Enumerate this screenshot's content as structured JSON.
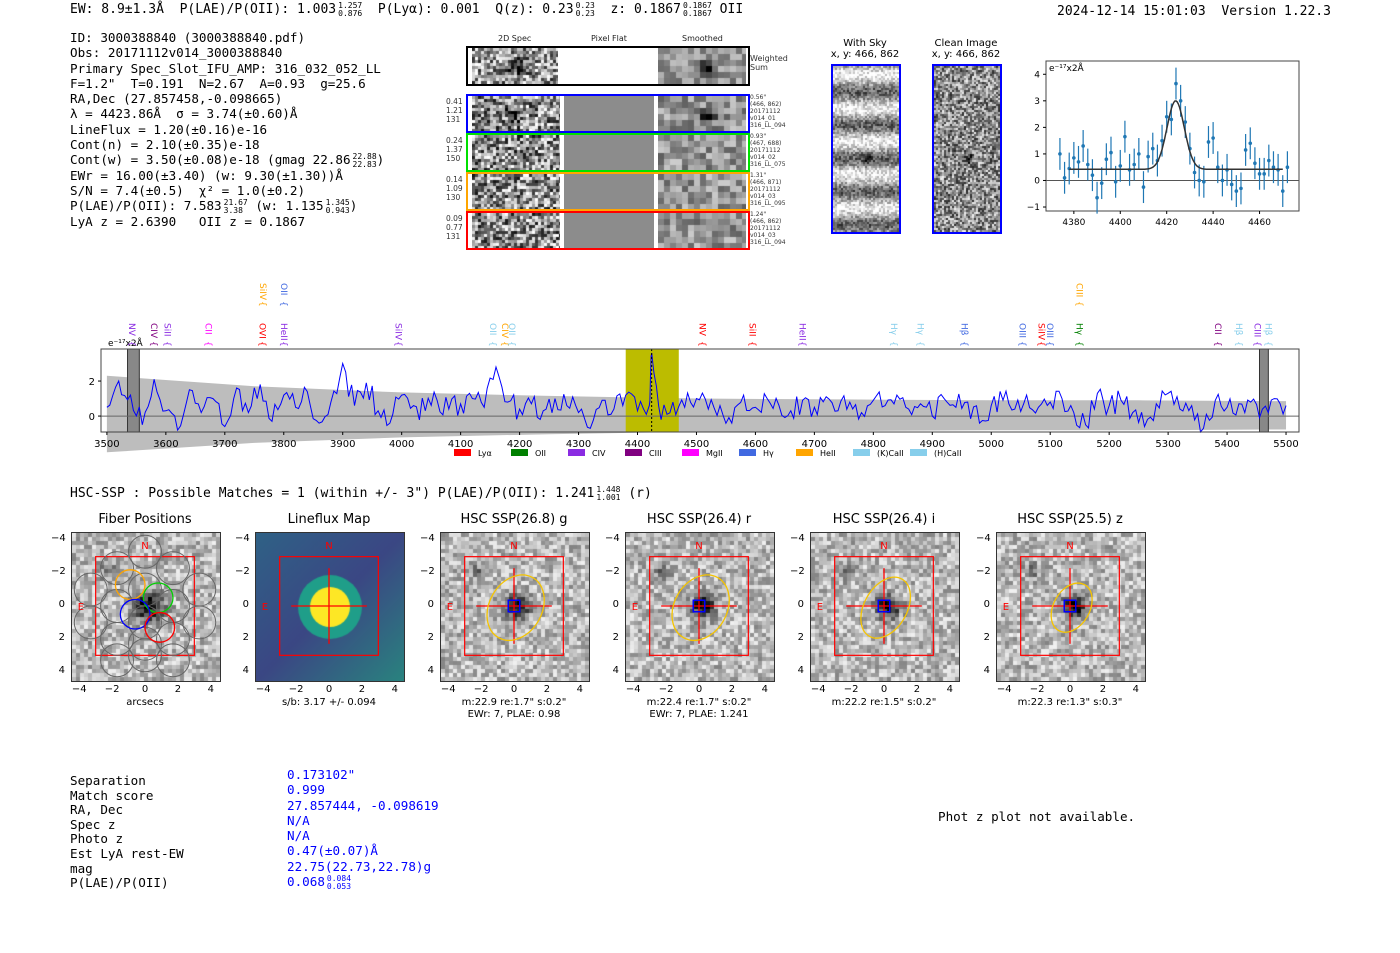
{
  "header": {
    "ew": "EW: 8.9±1.3Å",
    "plae_label": "P(LAE)/P(OII): 1.003",
    "plae_hi": "1.257",
    "plae_lo": "0.876",
    "plya": "P(Lyα): 0.001",
    "qz": "Q(z): 0.23",
    "qz_hi": "0.23",
    "qz_lo": "0.23",
    "z": "z: 0.1867",
    "z_hi": "0.1867",
    "z_lo": "0.1867",
    "z_line": "OII",
    "timestamp": "2024-12-14 15:01:03",
    "version": "Version 1.22.3"
  },
  "info": {
    "id": "ID: 3000388840 (3000388840.pdf)",
    "obs": "Obs: 20171112v014_3000388840",
    "primary": "Primary Spec_Slot_IFU_AMP: 316_032_052_LL",
    "params": "F=1.2\"  T=0.191  N=2.67  A=0.93  g=25.6",
    "radec": "RA,Dec (27.857458,-0.098665)",
    "lambda": "λ = 4423.86Å  σ = 3.74(±0.60)Å",
    "lineflux": "LineFlux = 1.20(±0.16)e-16",
    "contn": "Cont(n) = 2.10(±0.35)e-18",
    "contw": "Cont(w) = 3.50(±0.08)e-18 (gmag 22.86",
    "contw_hi": "22.88",
    "contw_lo": "22.83",
    "contw_end": ")",
    "ewr": "EWr = 16.00(±3.40) (w: 9.30(±1.30))Å",
    "sn": "S/N = 7.4(±0.5)  χ² = 1.0(±0.2)",
    "plae": "P(LAE)/P(OII): 7.583",
    "plae_hi": "21.67",
    "plae_lo": "3.38",
    "plae_w": "(w: 1.135",
    "plae_w_hi": "1.345",
    "plae_w_lo": "0.943",
    "plae_w_end": ")",
    "z": "LyA z = 2.6390   OII z = 0.1867"
  },
  "spec2d": {
    "columns": [
      "2D Spec",
      "Pixel Flat",
      "Smoothed"
    ],
    "weighted_label": "Weighted\nSum",
    "rows": [
      {
        "color": "#0000ff",
        "left": "0.41\n1.21\n131",
        "right": "0.56\"\n(466, 862)\n20171112\nv014_01\n316_LL_094"
      },
      {
        "color": "#00e000",
        "left": "0.24\n1.37\n150",
        "right": "0.93\"\n(467, 688)\n20171112\nv014_02\n316_LL_075"
      },
      {
        "color": "#ffa500",
        "left": "0.14\n1.09\n130",
        "right": "1.31\"\n(466, 871)\n20171112\nv014_03\n316_LL_095"
      },
      {
        "color": "#ff0000",
        "left": "0.09\n0.77\n131",
        "right": "1.24\"\n(466, 862)\n20171112\nv014_03\n316_LL_094"
      }
    ]
  },
  "cutouts": {
    "with_sky": "With Sky\nx, y: 466, 862",
    "clean": "Clean Image\nx, y: 466, 862"
  },
  "chart_data": [
    {
      "type": "scatter",
      "unit_label": "e⁻¹⁷x2Å",
      "xlim": [
        4368,
        4477
      ],
      "ylim": [
        -1.15,
        4.5
      ],
      "xticks": [
        "4380",
        "4400",
        "4420",
        "4440",
        "4460"
      ],
      "yticks": [
        "4",
        "3",
        "2",
        "1",
        "0",
        "−1"
      ],
      "points_x": [
        4374,
        4376,
        4378,
        4380,
        4382,
        4384,
        4386,
        4388,
        4390,
        4392,
        4394,
        4396,
        4398,
        4400,
        4402,
        4404,
        4406,
        4408,
        4410,
        4412,
        4414,
        4416,
        4418,
        4420,
        4422,
        4424,
        4426,
        4428,
        4430,
        4432,
        4434,
        4436,
        4438,
        4440,
        4442,
        4444,
        4446,
        4448,
        4450,
        4452,
        4454,
        4456,
        4458,
        4460,
        4462,
        4464,
        4466,
        4468,
        4470,
        4472
      ],
      "points_y": [
        1.0,
        0.1,
        0.45,
        0.85,
        0.7,
        1.3,
        0.6,
        0.2,
        -0.65,
        -0.1,
        0.8,
        1.05,
        -0.05,
        0.55,
        1.65,
        0.4,
        0.6,
        1.0,
        -0.25,
        0.9,
        1.2,
        0.75,
        1.5,
        2.4,
        2.3,
        3.65,
        3.0,
        2.2,
        1.2,
        0.3,
        0.0,
        -0.05,
        1.45,
        1.6,
        0.5,
        0.0,
        0.4,
        -0.15,
        -0.4,
        -0.3,
        1.15,
        1.4,
        0.65,
        0.25,
        0.25,
        0.75,
        0.5,
        0.4,
        -0.4,
        0.5
      ],
      "error": 0.6,
      "fit": {
        "center": 4423.86,
        "sigma": 3.74,
        "continuum": 0.42,
        "amplitude": 2.58,
        "range": [
          4378,
          4470
        ]
      }
    },
    {
      "type": "line",
      "unit_label": "e⁻¹⁷x2Å",
      "xlim": [
        3490,
        5522
      ],
      "ylim": [
        -0.91,
        3.83
      ],
      "xticks": [
        "3500",
        "3600",
        "3700",
        "3800",
        "3900",
        "4000",
        "4100",
        "4200",
        "4300",
        "4400",
        "4500",
        "4600",
        "4700",
        "4800",
        "4900",
        "5000",
        "5100",
        "5200",
        "5300",
        "5400",
        "5500"
      ],
      "yticks": [
        "2",
        "0"
      ],
      "x_start": 3500,
      "x_step": 20,
      "flux": [
        0.5,
        2.0,
        1.2,
        -0.5,
        2.1,
        0.3,
        -0.8,
        1.5,
        0.2,
        1.0,
        -0.6,
        1.6,
        0.2,
        1.8,
        -0.3,
        1.2,
        0.5,
        1.4,
        -0.4,
        0.8,
        3.0,
        0.6,
        1.9,
        0.3,
        -0.4,
        1.2,
        0.6,
        0.3,
        0.9,
        0.4,
        0.7,
        1.0,
        0.5,
        2.8,
        0.8,
        0.4,
        0.7,
        0.3,
        1.0,
        0.6,
        0.2,
        -0.7,
        0.9,
        0.4,
        1.2,
        0.3,
        0.6,
        -0.2,
        0.8,
        0.5,
        1.0,
        0.4,
        0.6,
        -0.4,
        1.2,
        0.5,
        1.0,
        0.6,
        0.3,
        0.9,
        0.5,
        1.1,
        0.3,
        0.8,
        0.2,
        0.9,
        0.6,
        1.2,
        0.4,
        0.7,
        0.0,
        1.0,
        0.5,
        0.8,
        -0.4,
        0.6,
        0.9,
        0.4,
        1.2,
        0.5,
        0.8,
        1.0,
        0.2,
        -0.5,
        1.3,
        0.6,
        0.9,
        0.2,
        -0.6,
        0.7,
        1.3,
        0.4,
        0.6,
        -0.7,
        0.9,
        0.5,
        0.7,
        0.8,
        0.4,
        1.0,
        0.6
      ],
      "peaks": [
        {
          "x": 4424,
          "y": 3.6
        }
      ],
      "error_band_x": [
        3500,
        3750,
        4000,
        4250,
        4500,
        4750,
        5000,
        5250,
        5500
      ],
      "error_band": [
        2.3,
        1.7,
        1.35,
        1.15,
        1.0,
        0.95,
        0.9,
        0.9,
        0.85
      ],
      "highlight_band": [
        4380,
        4470
      ],
      "highlight_color": "#bcbc00",
      "masked_bands": [
        [
          3535,
          3555
        ],
        [
          5455,
          5470
        ]
      ],
      "line_labels": [
        {
          "t": "NV",
          "w": 3543,
          "c": "#8a2be2",
          "r": 0
        },
        {
          "t": "CIV",
          "w": 3580,
          "c": "#800080",
          "r": 0
        },
        {
          "t": "SiII",
          "w": 3603,
          "c": "#8a2be2",
          "r": 0
        },
        {
          "t": "CII",
          "w": 3672,
          "c": "#ff00ff",
          "r": 0
        },
        {
          "t": "OVI",
          "w": 3764,
          "c": "#ff0000",
          "r": 0
        },
        {
          "t": "HeII",
          "w": 3800,
          "c": "#8a2be2",
          "r": 0
        },
        {
          "t": "SiIV",
          "w": 3765,
          "c": "#ffa500",
          "r": 1
        },
        {
          "t": "OII",
          "w": 3800,
          "c": "#4169e1",
          "r": 1
        },
        {
          "t": "SiIV",
          "w": 3995,
          "c": "#8a2be2",
          "r": 0
        },
        {
          "t": "OII",
          "w": 4155,
          "c": "#87ceeb",
          "r": 0
        },
        {
          "t": "CIV",
          "w": 4175,
          "c": "#ffa500",
          "r": 0
        },
        {
          "t": "OII",
          "w": 4187,
          "c": "#87ceeb",
          "r": 0
        },
        {
          "t": "NV",
          "w": 4510,
          "c": "#ff0000",
          "r": 0
        },
        {
          "t": "SiII",
          "w": 4595,
          "c": "#ff0000",
          "r": 0
        },
        {
          "t": "HeII",
          "w": 4680,
          "c": "#8a2be2",
          "r": 0
        },
        {
          "t": "Hγ",
          "w": 4835,
          "c": "#87ceeb",
          "r": 0
        },
        {
          "t": "Hγ",
          "w": 4880,
          "c": "#87ceeb",
          "r": 0
        },
        {
          "t": "Hβ",
          "w": 4955,
          "c": "#4169e1",
          "r": 0
        },
        {
          "t": "OIII",
          "w": 5053,
          "c": "#4169e1",
          "r": 0
        },
        {
          "t": "SiIV",
          "w": 5085,
          "c": "#ff0000",
          "r": 0
        },
        {
          "t": "OIII",
          "w": 5100,
          "c": "#4169e1",
          "r": 0
        },
        {
          "t": "Hγ",
          "w": 5150,
          "c": "#008000",
          "r": 0
        },
        {
          "t": "CIII",
          "w": 5150,
          "c": "#ffa500",
          "r": 1
        },
        {
          "t": "CII",
          "w": 5385,
          "c": "#800080",
          "r": 0
        },
        {
          "t": "Hβ",
          "w": 5420,
          "c": "#87ceeb",
          "r": 0
        },
        {
          "t": "CIII",
          "w": 5452,
          "c": "#8a2be2",
          "r": 0
        },
        {
          "t": "Hβ",
          "w": 5470,
          "c": "#87ceeb",
          "r": 0
        }
      ],
      "legend": [
        {
          "t": "Lyα",
          "c": "#ff0000"
        },
        {
          "t": "OII",
          "c": "#008000"
        },
        {
          "t": "CIV",
          "c": "#8a2be2"
        },
        {
          "t": "CIII",
          "c": "#800080"
        },
        {
          "t": "MgII",
          "c": "#ff00ff"
        },
        {
          "t": "Hγ",
          "c": "#4169e1"
        },
        {
          "t": "HeII",
          "c": "#ffa500"
        },
        {
          "t": "(K)CaII",
          "c": "#87ceeb"
        },
        {
          "t": "(H)CaII",
          "c": "#87ceeb"
        }
      ],
      "legend_placement": "bottom"
    }
  ],
  "hsc": {
    "heading": "HSC-SSP : Possible Matches = 1 (within +/- 3\")  P(LAE)/P(OII): 1.241",
    "heading_hi": "1.448",
    "heading_lo": "1.001",
    "heading_end": "(r)",
    "ticks": [
      "4",
      "2",
      "0",
      "−2",
      "−4"
    ],
    "xticks": [
      "−4",
      "−2",
      "0",
      "2",
      "4"
    ],
    "compass_n": "N",
    "compass_e": "E",
    "panels": [
      {
        "title": "Fiber Positions",
        "caption": "arcsecs",
        "caption2": ""
      },
      {
        "title": "Lineflux Map",
        "caption": "s/b: 3.17 +/- 0.094",
        "caption2": ""
      },
      {
        "title": "HSC SSP(26.8) g",
        "caption": "m:22.9  re:1.7\"  s:0.2\"",
        "caption2": "EWr: 7, PLAE: 0.98"
      },
      {
        "title": "HSC SSP(26.4) r",
        "caption": "m:22.4  re:1.7\"  s:0.2\"",
        "caption2": "EWr: 7, PLAE: 1.241"
      },
      {
        "title": "HSC SSP(26.4) i",
        "caption": "m:22.2  re:1.5\"  s:0.2\"",
        "caption2": ""
      },
      {
        "title": "HSC SSP(25.5) z",
        "caption": "m:22.3  re:1.3\"  s:0.3\"",
        "caption2": ""
      }
    ]
  },
  "match": {
    "labels": [
      "Separation",
      "Match score",
      "RA, Dec",
      "Spec z",
      "Photo z",
      "Est LyA rest-EW",
      "mag",
      "P(LAE)/P(OII)"
    ],
    "values": [
      "0.173102\"",
      "0.999",
      "27.857444, -0.098619",
      "N/A",
      "N/A",
      "0.47(±0.07)Å",
      "22.75(22.73,22.78)g",
      "0.068"
    ],
    "plae_hi": "0.084",
    "plae_lo": "0.053",
    "photz_note": "Phot z plot not available."
  }
}
